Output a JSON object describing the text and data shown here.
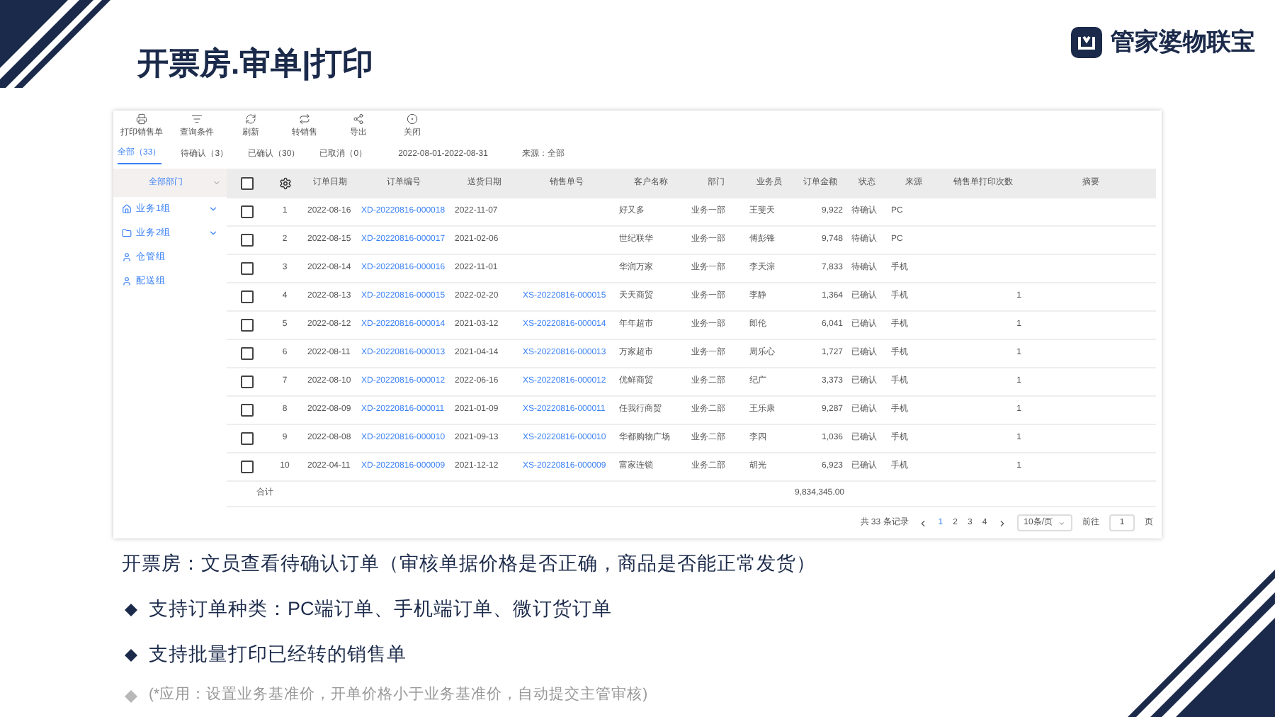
{
  "slide_title": "开票房.审单|打印",
  "logo": {
    "text": "管家婆物联宝"
  },
  "toolbar": [
    "打印销售单",
    "查询条件",
    "刷新",
    "转销售",
    "导出",
    "关闭"
  ],
  "tabs": [
    {
      "label": "全部（33）",
      "selected": true
    },
    {
      "label": "待确认（3）",
      "selected": false
    },
    {
      "label": "已确认（30）",
      "selected": false
    },
    {
      "label": "已取消（0）",
      "selected": false
    }
  ],
  "date_range": "2022-08-01-2022-08-31",
  "source_filter": "来源：全部",
  "sidebar": {
    "dropdown": "全部部门",
    "items": [
      {
        "label": "业务1组",
        "kind": "home",
        "expandable": true
      },
      {
        "label": "业务2组",
        "kind": "folder",
        "expandable": true
      },
      {
        "label": "仓管组",
        "kind": "person",
        "expandable": false
      },
      {
        "label": "配送组",
        "kind": "person",
        "expandable": false
      }
    ]
  },
  "table": {
    "header_checked": false,
    "columns": [
      "订单日期",
      "订单编号",
      "送货日期",
      "销售单号",
      "客户名称",
      "部门",
      "业务员",
      "订单金额",
      "状态",
      "来源",
      "销售单打印次数",
      "摘要"
    ],
    "rows": [
      {
        "checked": false,
        "no": "1",
        "date": "2022-08-16",
        "order": "XD-20220816-000018",
        "delivery": "2022-11-07",
        "sales": "",
        "customer": "好又多",
        "dept": "业务一部",
        "person": "王斐天",
        "amount": "9,922",
        "status": "待确认",
        "source": "PC",
        "prints": ""
      },
      {
        "checked": false,
        "no": "2",
        "date": "2022-08-15",
        "order": "XD-20220816-000017",
        "delivery": "2021-02-06",
        "sales": "",
        "customer": "世纪联华",
        "dept": "业务一部",
        "person": "傅彭锋",
        "amount": "9,748",
        "status": "待确认",
        "source": "PC",
        "prints": ""
      },
      {
        "checked": false,
        "no": "3",
        "date": "2022-08-14",
        "order": "XD-20220816-000016",
        "delivery": "2022-11-01",
        "sales": "",
        "customer": "华润万家",
        "dept": "业务一部",
        "person": "李天淙",
        "amount": "7,833",
        "status": "待确认",
        "source": "手机",
        "prints": ""
      },
      {
        "checked": false,
        "no": "4",
        "date": "2022-08-13",
        "order": "XD-20220816-000015",
        "delivery": "2022-02-20",
        "sales": "XS-20220816-000015",
        "customer": "天天商贸",
        "dept": "业务一部",
        "person": "李静",
        "amount": "1,364",
        "status": "已确认",
        "source": "手机",
        "prints": "1"
      },
      {
        "checked": false,
        "no": "5",
        "date": "2022-08-12",
        "order": "XD-20220816-000014",
        "delivery": "2021-03-12",
        "sales": "XS-20220816-000014",
        "customer": "年年超市",
        "dept": "业务一部",
        "person": "郎伦",
        "amount": "6,041",
        "status": "已确认",
        "source": "手机",
        "prints": "1"
      },
      {
        "checked": false,
        "no": "6",
        "date": "2022-08-11",
        "order": "XD-20220816-000013",
        "delivery": "2021-04-14",
        "sales": "XS-20220816-000013",
        "customer": "万家超市",
        "dept": "业务一部",
        "person": "周乐心",
        "amount": "1,727",
        "status": "已确认",
        "source": "手机",
        "prints": "1"
      },
      {
        "checked": false,
        "no": "7",
        "date": "2022-08-10",
        "order": "XD-20220816-000012",
        "delivery": "2022-06-16",
        "sales": "XS-20220816-000012",
        "customer": "优鲜商贸",
        "dept": "业务二部",
        "person": "纪广",
        "amount": "3,373",
        "status": "已确认",
        "source": "手机",
        "prints": "1"
      },
      {
        "checked": false,
        "no": "8",
        "date": "2022-08-09",
        "order": "XD-20220816-000011",
        "delivery": "2021-01-09",
        "sales": "XS-20220816-000011",
        "customer": "任我行商贸",
        "dept": "业务二部",
        "person": "王乐康",
        "amount": "9,287",
        "status": "已确认",
        "source": "手机",
        "prints": "1"
      },
      {
        "checked": false,
        "no": "9",
        "date": "2022-08-08",
        "order": "XD-20220816-000010",
        "delivery": "2021-09-13",
        "sales": "XS-20220816-000010",
        "customer": "华都购物广场",
        "dept": "业务二部",
        "person": "李四",
        "amount": "1,036",
        "status": "已确认",
        "source": "手机",
        "prints": "1"
      },
      {
        "checked": false,
        "no": "10",
        "date": "2022-04-11",
        "order": "XD-20220816-000009",
        "delivery": "2021-12-12",
        "sales": "XS-20220816-000009",
        "customer": "富家连锁",
        "dept": "业务二部",
        "person": "胡光",
        "amount": "6,923",
        "status": "已确认",
        "source": "手机",
        "prints": "1"
      }
    ],
    "total_label": "合计",
    "total_amount": "9,834,345.00"
  },
  "pagination": {
    "total": "共 33 条记录",
    "pages": [
      {
        "label": "1",
        "selected": true
      },
      {
        "label": "2",
        "selected": false
      },
      {
        "label": "3",
        "selected": false
      },
      {
        "label": "4",
        "selected": false
      }
    ],
    "page_size": "10条/页",
    "goto_label": "前往",
    "goto_value": "1",
    "goto_suffix": "页"
  },
  "description": "开票房：文员查看待确认订单（审核单据价格是否正确，商品是否能正常发货）",
  "bullets": [
    {
      "text": "支持订单种类：PC端订单、手机端订单、微订货订单",
      "kind": "main"
    },
    {
      "text": "支持批量打印已经转的销售单",
      "kind": "main"
    },
    {
      "text": "(*应用：设置业务基准价，开单价格小于业务基准价，自动提交主管审核)",
      "kind": "note"
    }
  ]
}
